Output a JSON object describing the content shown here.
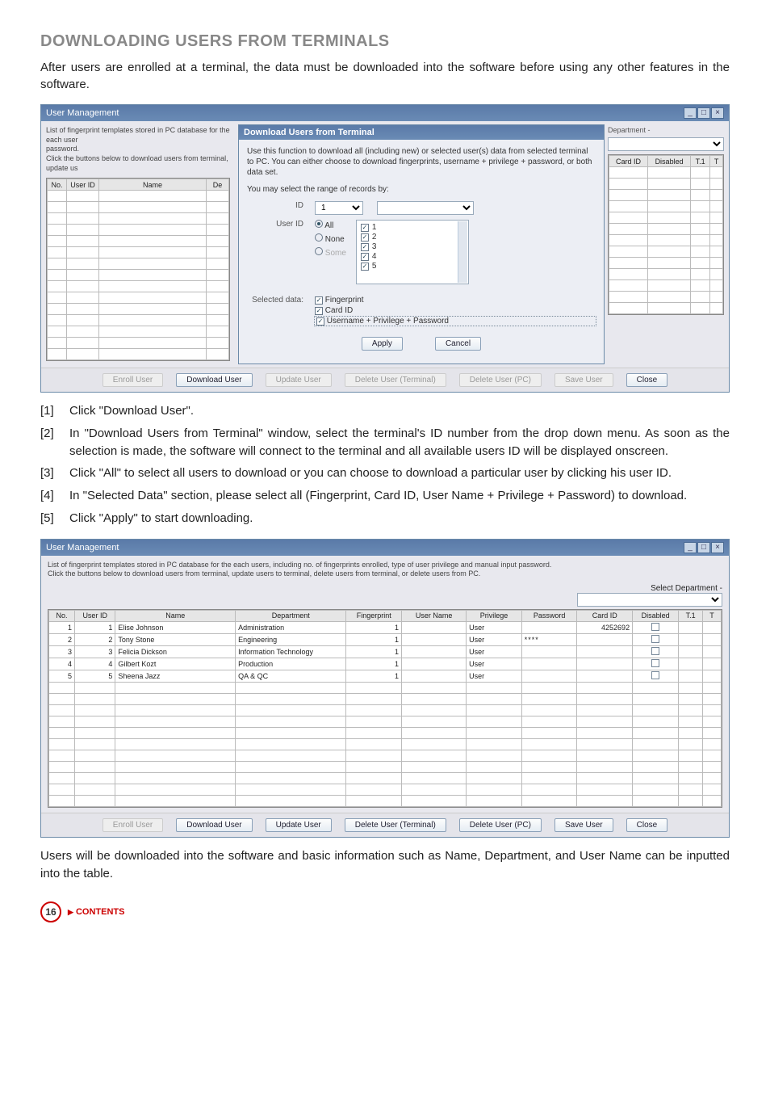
{
  "heading": "DOWNLOADING USERS FROM TERMINALS",
  "intro": "After users are enrolled at a terminal, the data must be downloaded into the software before using any other features in the software.",
  "win1": {
    "title": "User Management",
    "leftDesc1": "List of fingerprint templates stored in PC database for the each user",
    "leftDesc2": "password.",
    "leftDesc3": "Click the buttons below to download users from terminal, update us",
    "cols": {
      "no": "No.",
      "uid": "User ID",
      "name": "Name",
      "dep": "De"
    },
    "dialogTitle": "Download Users from Terminal",
    "dlgDesc": "Use this function to download all (including new) or selected user(s) data from selected terminal to PC. You can either choose to download fingerprints, username + privilege + password, or both data set.",
    "rangeLabel": "You may select the range of records by:",
    "idLabel": "ID",
    "idValue": "1",
    "userIdLabel": "User ID",
    "radioAll": "All",
    "radioNone": "None",
    "radioSome": "Some",
    "items": [
      "1",
      "2",
      "3",
      "4",
      "5"
    ],
    "selDataLabel": "Selected data:",
    "selData": [
      "Fingerprint",
      "Card ID",
      "Username + Privilege + Password"
    ],
    "apply": "Apply",
    "cancel": "Cancel",
    "deptLabel": "Department -",
    "rcols": {
      "card": "Card ID",
      "dis": "Disabled",
      "t1a": "T.1",
      "t1b": "T"
    }
  },
  "footerBtns": {
    "enroll": "Enroll User",
    "download": "Download User",
    "update": "Update User",
    "delTerm": "Delete User (Terminal)",
    "delPC": "Delete User (PC)",
    "save": "Save User",
    "close": "Close"
  },
  "steps": [
    {
      "n": "[1]",
      "t": "Click \"Download User\"."
    },
    {
      "n": "[2]",
      "t": "In \"Download Users from Terminal\" window, select the terminal's ID number from the drop down menu. As soon as the selection is made, the software will connect to the terminal and all available users ID will be displayed onscreen."
    },
    {
      "n": "[3]",
      "t": "Click \"All\" to select all users to download or you can choose to download a particular user by clicking his user ID."
    },
    {
      "n": "[4]",
      "t": "In \"Selected Data\" section, please select all (Fingerprint, Card ID, User Name + Privilege + Password) to download."
    },
    {
      "n": "[5]",
      "t": "Click \"Apply\" to start downloading."
    }
  ],
  "win2": {
    "title": "User Management",
    "desc1": "List of fingerprint templates stored in PC database for the each users, including no. of fingerprints enrolled, type of user privilege and manual input password.",
    "desc2": "Click the buttons below to download users from terminal, update users to terminal, delete users from terminal, or delete users from PC.",
    "selectDept": "Select Department -",
    "headers": {
      "no": "No.",
      "uid": "User ID",
      "name": "Name",
      "dep": "Department",
      "fp": "Fingerprint",
      "un": "User Name",
      "priv": "Privilege",
      "pw": "Password",
      "card": "Card ID",
      "dis": "Disabled",
      "t1a": "T.1",
      "t1b": "T"
    },
    "rows": [
      {
        "no": "1",
        "uid": "1",
        "name": "Elise Johnson",
        "dep": "Administration",
        "fp": "1",
        "un": "",
        "priv": "User",
        "pw": "",
        "card": "4252692",
        "dis": false
      },
      {
        "no": "2",
        "uid": "2",
        "name": "Tony Stone",
        "dep": "Engineering",
        "fp": "1",
        "un": "",
        "priv": "User",
        "pw": "****",
        "card": "",
        "dis": false
      },
      {
        "no": "3",
        "uid": "3",
        "name": "Felicia Dickson",
        "dep": "Information Technology",
        "fp": "1",
        "un": "",
        "priv": "User",
        "pw": "",
        "card": "",
        "dis": false
      },
      {
        "no": "4",
        "uid": "4",
        "name": "Gilbert Kozt",
        "dep": "Production",
        "fp": "1",
        "un": "",
        "priv": "User",
        "pw": "",
        "card": "",
        "dis": false
      },
      {
        "no": "5",
        "uid": "5",
        "name": "Sheena Jazz",
        "dep": "QA & QC",
        "fp": "1",
        "un": "",
        "priv": "User",
        "pw": "",
        "card": "",
        "dis": false
      }
    ]
  },
  "closing": "Users will be downloaded into the software and basic information such as Name, Department, and User Name can be inputted into the table.",
  "pageNum": "16",
  "contents": "CONTENTS"
}
